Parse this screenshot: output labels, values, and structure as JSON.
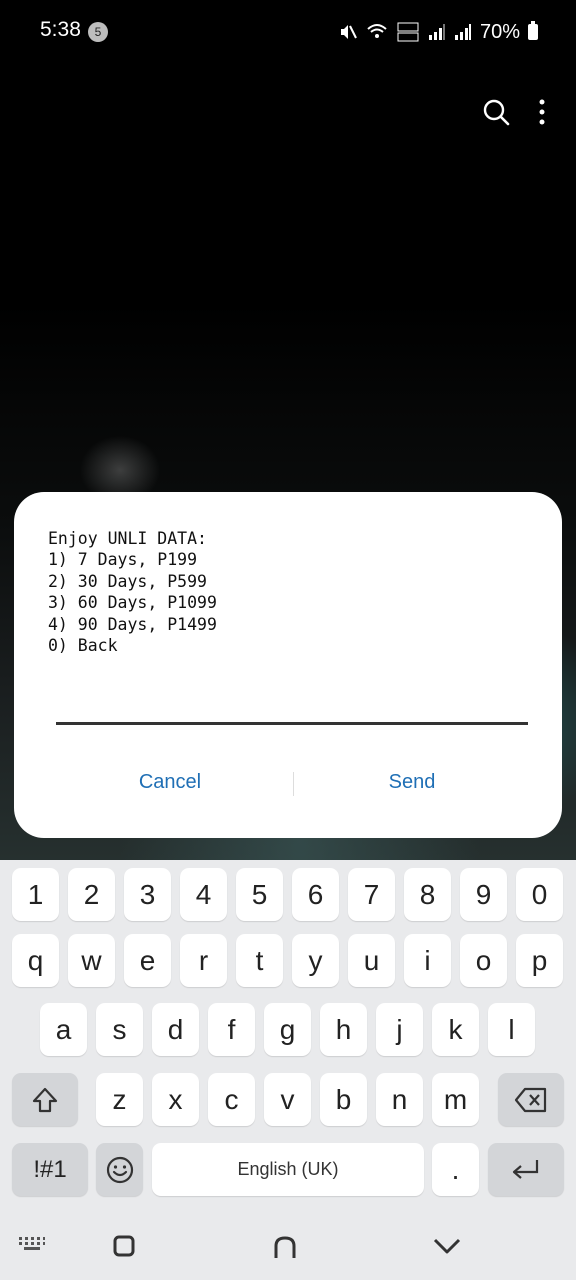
{
  "status_bar": {
    "time": "5:38",
    "notification_count": "5",
    "battery": "70%"
  },
  "dialog": {
    "message": "Enjoy UNLI DATA:\n1) 7 Days, P199\n2) 30 Days, P599\n3) 60 Days, P1099\n4) 90 Days, P1499\n0) Back",
    "input_value": "",
    "cancel_label": "Cancel",
    "send_label": "Send",
    "accent_color": "#1f6fb5"
  },
  "keyboard": {
    "row1": [
      "1",
      "2",
      "3",
      "4",
      "5",
      "6",
      "7",
      "8",
      "9",
      "0"
    ],
    "row2": [
      "q",
      "w",
      "e",
      "r",
      "t",
      "y",
      "u",
      "i",
      "o",
      "p"
    ],
    "row3": [
      "a",
      "s",
      "d",
      "f",
      "g",
      "h",
      "j",
      "k",
      "l"
    ],
    "row4": [
      "z",
      "x",
      "c",
      "v",
      "b",
      "n",
      "m"
    ],
    "symbols_label": "!#1",
    "space_label": "English (UK)",
    "period_label": "."
  }
}
